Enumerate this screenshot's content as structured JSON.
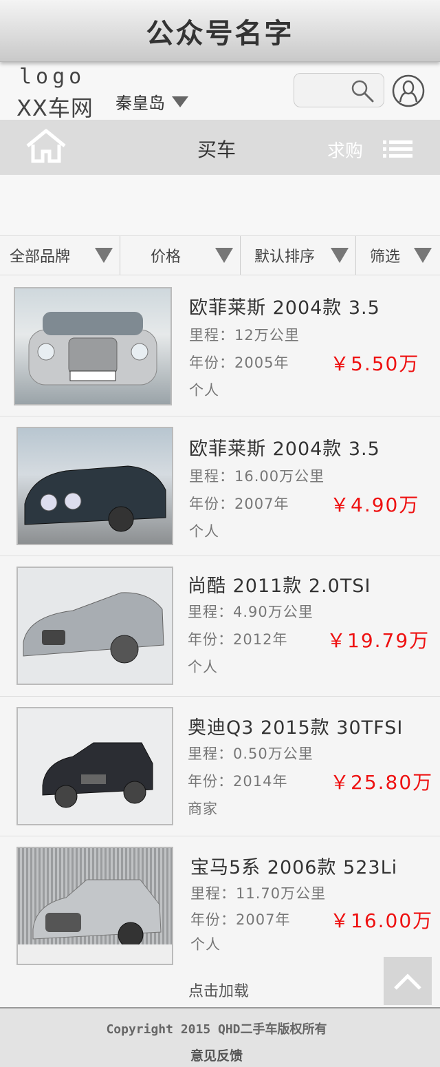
{
  "app": {
    "title": "公众号名字"
  },
  "header": {
    "logo_top": "logo",
    "logo_bottom": "XX车网",
    "city": "秦皇岛"
  },
  "nav": {
    "title": "买车",
    "buy_label": "求购"
  },
  "filters": [
    "全部品牌",
    "价格",
    "默认排序",
    "筛选"
  ],
  "listings": [
    {
      "title": "欧菲莱斯 2004款 3.5",
      "mileage": "里程：12万公里",
      "year": "年份：2005年",
      "price": "￥5.50万",
      "seller": "个人"
    },
    {
      "title": "欧菲莱斯 2004款 3.5",
      "mileage": "里程：16.00万公里",
      "year": "年份：2007年",
      "price": "￥4.90万",
      "seller": "个人"
    },
    {
      "title": "尚酷 2011款 2.0TSI",
      "mileage": "里程：4.90万公里",
      "year": "年份：2012年",
      "price": "￥19.79万",
      "seller": "个人"
    },
    {
      "title": "奥迪Q3 2015款 30TFSI",
      "mileage": "里程：0.50万公里",
      "year": "年份：2014年",
      "price": "￥25.80万",
      "seller": "商家"
    },
    {
      "title": "宝马5系 2006款 523Li",
      "mileage": "里程：11.70万公里",
      "year": "年份：2007年",
      "price": "￥16.00万",
      "seller": "个人"
    }
  ],
  "load_more": "点击加载",
  "footer": {
    "copyright": "Copyright 2015 QHD二手车版权所有",
    "feedback": "意见反馈"
  },
  "colors": {
    "price": "#e11111",
    "nav_bg": "#dcdcdc",
    "footer_bg": "#e3e3e3"
  }
}
